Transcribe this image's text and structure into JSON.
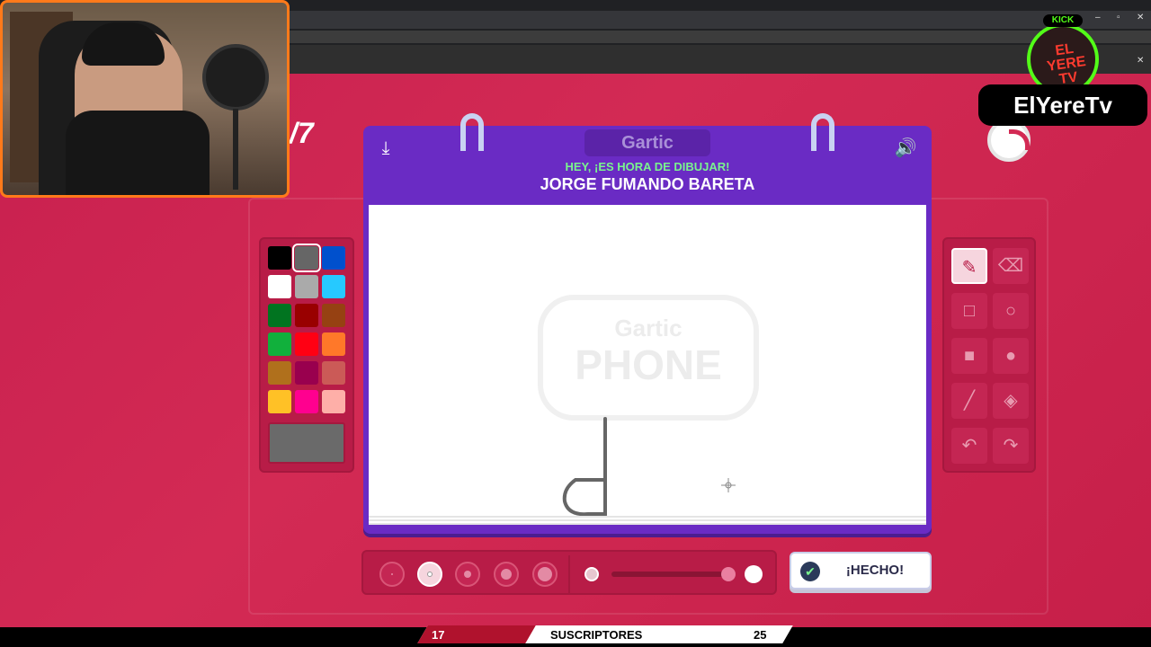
{
  "round": {
    "text": "/7"
  },
  "frame": {
    "logo": "Gartic",
    "subtitle": "HEY, ¡ES HORA DE DIBUJAR!",
    "title": "JORGE FUMANDO BARETA",
    "watermark_top": "Gartic",
    "watermark_bottom": "PHONE"
  },
  "streamer": {
    "platform_tag": "KICK",
    "logo_text": "EL YERE TV",
    "name": "ElYereTv"
  },
  "palette": {
    "colors": [
      "#000000",
      "#666666",
      "#0050cd",
      "#ffffff",
      "#aaaaaa",
      "#26c9ff",
      "#017420",
      "#990000",
      "#964112",
      "#11b03c",
      "#ff0013",
      "#ff7829",
      "#b0701c",
      "#99004e",
      "#cb5a57",
      "#ffc126",
      "#ff008f",
      "#feafa8"
    ],
    "selected_color": "#666666"
  },
  "tools": [
    "pencil",
    "eraser",
    "square-outline",
    "circle-outline",
    "square-filled",
    "circle-filled",
    "line",
    "fill",
    "undo",
    "redo"
  ],
  "done_button": {
    "label": "¡HECHO!"
  },
  "subscribers": {
    "current": "17",
    "label": "SUSCRIPTORES",
    "goal": "25"
  }
}
